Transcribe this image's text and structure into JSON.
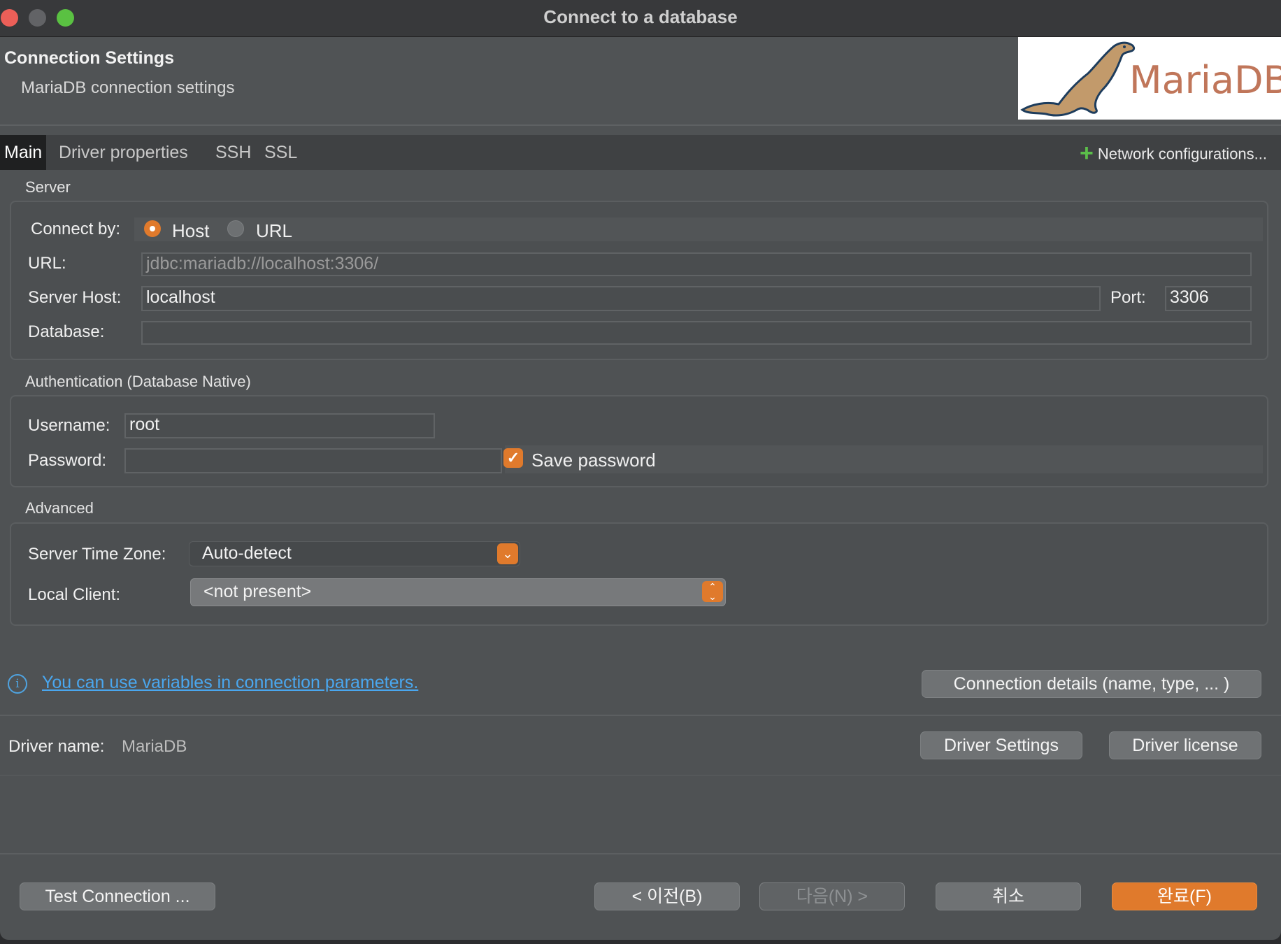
{
  "window": {
    "title": "Connect to a database"
  },
  "header": {
    "title": "Connection Settings",
    "subtitle": "MariaDB connection settings",
    "logo_text": "MariaDB"
  },
  "tabs": [
    "Main",
    "Driver properties",
    "SSH",
    "SSL"
  ],
  "network_config": {
    "label": "Network configurations...",
    "icon": "plus-icon"
  },
  "server": {
    "group_label": "Server",
    "connect_by_label": "Connect by:",
    "connect_by_options": [
      "Host",
      "URL"
    ],
    "connect_by_selected": "Host",
    "url_label": "URL:",
    "url_value": "jdbc:mariadb://localhost:3306/",
    "host_label": "Server Host:",
    "host_value": "localhost",
    "port_label": "Port:",
    "port_value": "3306",
    "database_label": "Database:",
    "database_value": ""
  },
  "auth": {
    "group_label": "Authentication (Database Native)",
    "username_label": "Username:",
    "username_value": "root",
    "password_label": "Password:",
    "password_value": "",
    "save_password_label": "Save password",
    "save_password_checked": true
  },
  "advanced": {
    "group_label": "Advanced",
    "timezone_label": "Server Time Zone:",
    "timezone_value": "Auto-detect",
    "local_client_label": "Local Client:",
    "local_client_value": "<not present>"
  },
  "info": {
    "link_text": "You can use variables in connection parameters.",
    "connection_details_button": "Connection details (name, type, ... )"
  },
  "driver": {
    "name_label": "Driver name:",
    "name_value": "MariaDB",
    "settings_button": "Driver Settings",
    "license_button": "Driver license"
  },
  "footer": {
    "test_button": "Test Connection ...",
    "back_button": "< 이전(B)",
    "next_button": "다음(N) >",
    "cancel_button": "취소",
    "finish_button": "완료(F)"
  },
  "colors": {
    "accent": "#e07a2c",
    "link": "#4aa7ef",
    "add": "#5bbf4a"
  }
}
